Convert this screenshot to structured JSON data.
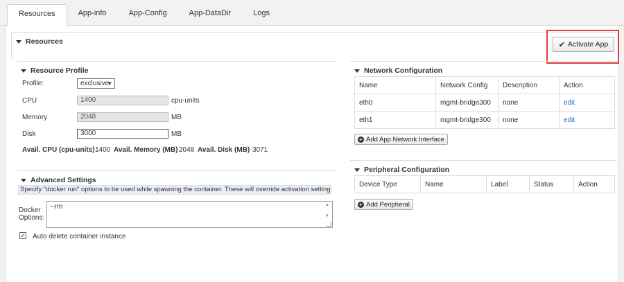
{
  "tabs": [
    {
      "label": "Resources",
      "active": true
    },
    {
      "label": "App-info"
    },
    {
      "label": "App-Config"
    },
    {
      "label": "App-DataDir"
    },
    {
      "label": "Logs"
    }
  ],
  "resources": {
    "title": "Resources",
    "activate_label": "Activate App"
  },
  "profile": {
    "title": "Resource Profile",
    "profile_label": "Profile:",
    "profile_value": "exclusive",
    "cpu_label": "CPU",
    "cpu_value": "1400",
    "cpu_unit": "cpu-units",
    "memory_label": "Memory",
    "memory_value": "2048",
    "memory_unit": "MB",
    "disk_label": "Disk",
    "disk_value": "3000",
    "disk_unit": "MB",
    "avail_cpu_label": "Avail. CPU (cpu-units)",
    "avail_cpu_value": "1400",
    "avail_memory_label": "Avail. Memory (MB)",
    "avail_memory_value": "2048",
    "avail_disk_label": "Avail. Disk (MB)",
    "avail_disk_value": "3071"
  },
  "advanced": {
    "title": "Advanced Settings",
    "hint": "Specify \"docker run\" options to be used while spawning the container. These will override activation settings above.",
    "docker_label_1": "Docker",
    "docker_label_2": "Options:",
    "docker_value": "--rm",
    "auto_delete_label": "Auto delete container instance",
    "auto_delete_checked": true
  },
  "network": {
    "title": "Network Configuration",
    "columns": [
      "Name",
      "Network Config",
      "Description",
      "Action"
    ],
    "rows": [
      {
        "name": "eth0",
        "config": "mgmt-bridge300",
        "description": "none",
        "action": "edit"
      },
      {
        "name": "eth1",
        "config": "mgmt-bridge300",
        "description": "none",
        "action": "edit"
      }
    ],
    "add_label": "Add App Network Interface"
  },
  "peripheral": {
    "title": "Peripheral Configuration",
    "columns": [
      "Device Type",
      "Name",
      "Label",
      "Status",
      "Action"
    ],
    "add_label": "Add Peripheral"
  }
}
